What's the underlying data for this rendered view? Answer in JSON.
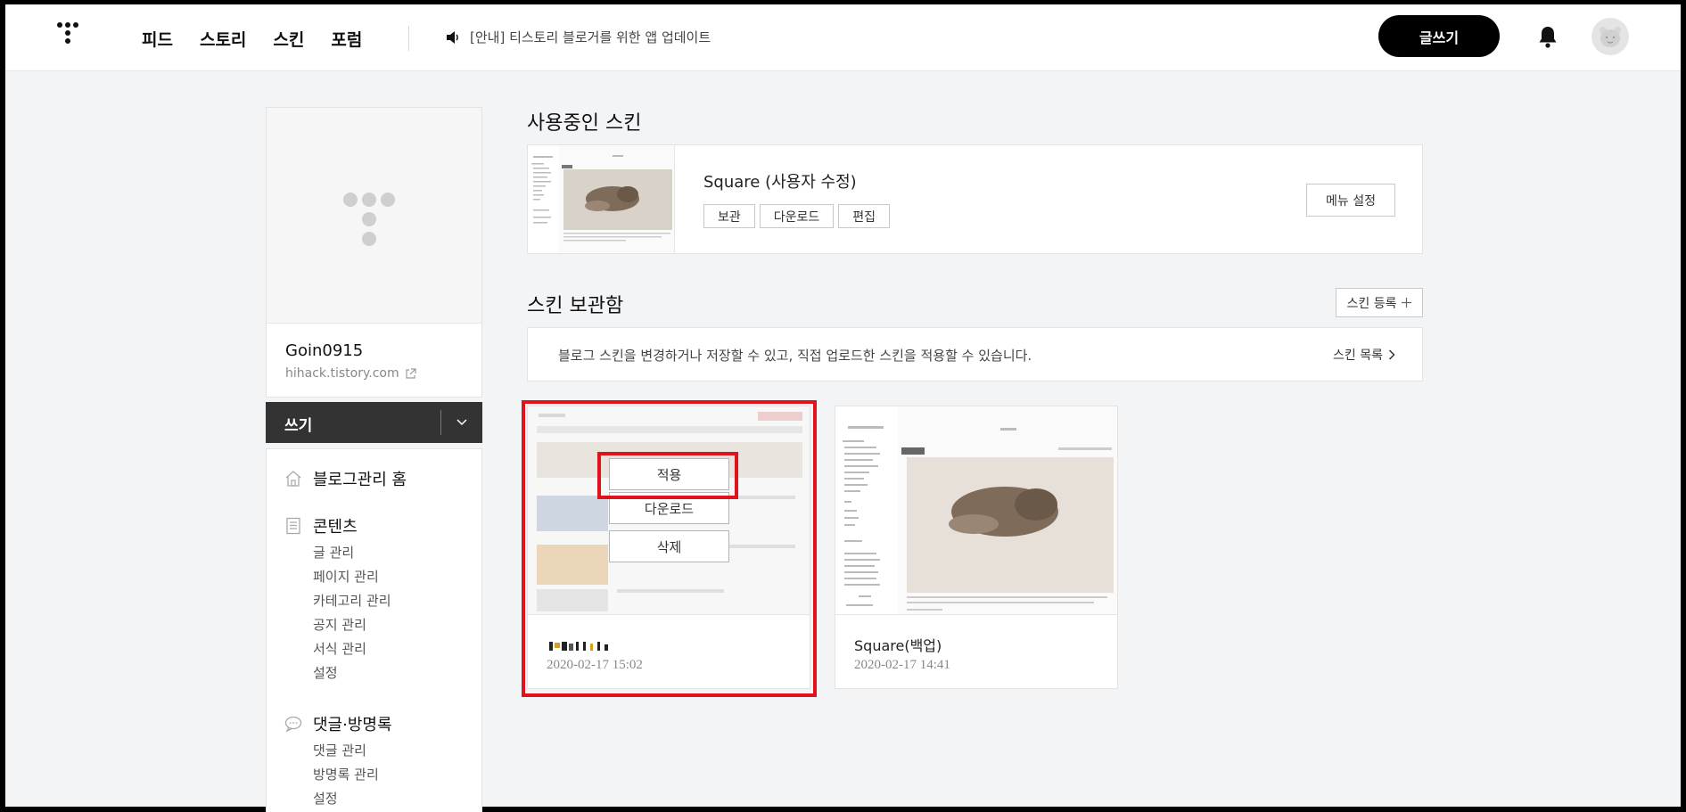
{
  "nav": {
    "items": [
      "피드",
      "스토리",
      "스킨",
      "포럼"
    ]
  },
  "notice": {
    "text": "[안내] 티스토리 블로거를 위한 앱 업데이트"
  },
  "header": {
    "write_label": "글쓰기"
  },
  "profile": {
    "blog_name": "Goin0915",
    "blog_url": "hihack.tistory.com"
  },
  "sidebar": {
    "write_label": "쓰기",
    "home_label": "블로그관리 홈",
    "contents": {
      "title": "콘텐츠",
      "items": [
        "글 관리",
        "페이지 관리",
        "카테고리 관리",
        "공지 관리",
        "서식 관리",
        "설정"
      ]
    },
    "comments": {
      "title": "댓글·방명록",
      "items": [
        "댓글 관리",
        "방명록 관리",
        "설정"
      ]
    }
  },
  "current_skin": {
    "section_title": "사용중인 스킨",
    "name": "Square (사용자 수정)",
    "buttons": [
      "보관",
      "다운로드",
      "편집"
    ],
    "menu_setting_label": "메뉴 설정"
  },
  "skin_storage": {
    "section_title": "스킨 보관함",
    "register_label": "스킨 등록",
    "info_text": "블로그 스킨을 변경하거나 저장할 수 있고, 직접 업로드한 스킨을 적용할 수 있습니다.",
    "list_link": "스킨 목록",
    "cards": [
      {
        "name": "",
        "date": "2020-02-17 15:02",
        "overlay": [
          "적용",
          "다운로드",
          "삭제"
        ]
      },
      {
        "name": "Square(백업)",
        "date": "2020-02-17 14:41"
      }
    ]
  },
  "colors": {
    "accent": "#000000",
    "highlight": "#e0121c"
  }
}
